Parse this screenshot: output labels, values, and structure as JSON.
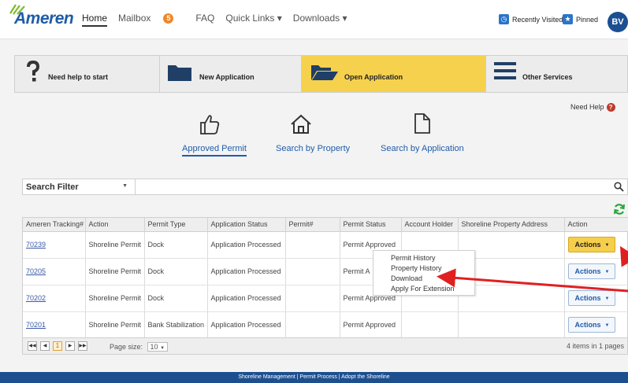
{
  "brand": {
    "name": "Ameren"
  },
  "nav": {
    "items": [
      {
        "label": "Home"
      },
      {
        "label": "Mailbox",
        "badge": "5"
      },
      {
        "label": "FAQ"
      },
      {
        "label": "Quick Links ▾"
      },
      {
        "label": "Downloads ▾"
      }
    ]
  },
  "topRight": {
    "recent": "Recently Visited",
    "pinned": "Pinned",
    "avatar": "BV"
  },
  "tiles": [
    {
      "label": "Need help to start",
      "icon": "question-icon"
    },
    {
      "label": "New Application",
      "icon": "folder-icon"
    },
    {
      "label": "Open Application",
      "icon": "folder-open-icon",
      "highlight_color": "#f6d14e"
    },
    {
      "label": "Other Services",
      "icon": "menu-bars-icon"
    }
  ],
  "help": {
    "label": "Need Help"
  },
  "searchOptions": [
    {
      "label": "Approved Permit",
      "icon": "thumbs-up-icon",
      "selected": true
    },
    {
      "label": "Search by Property",
      "icon": "home-icon"
    },
    {
      "label": "Search by Application",
      "icon": "document-icon"
    }
  ],
  "filter": {
    "label": "Search Filter"
  },
  "table": {
    "headers": [
      "Ameren Tracking#",
      "Action",
      "Permit Type",
      "Application Status",
      "Permit#",
      "Permit Status",
      "Account Holder",
      "Shoreline Property Address",
      "Action"
    ],
    "rows": [
      {
        "tracking": "70239",
        "action": "Shoreline Permit",
        "permit_type": "Dock",
        "app_status": "Application Processed",
        "permit_no": "",
        "permit_status": "Permit Approved",
        "holder": "",
        "address": "",
        "button": "Actions"
      },
      {
        "tracking": "70205",
        "action": "Shoreline Permit",
        "permit_type": "Dock",
        "app_status": "Application Processed",
        "permit_no": "",
        "permit_status": "Permit A",
        "holder": "",
        "address": "",
        "button": "Actions"
      },
      {
        "tracking": "70202",
        "action": "Shoreline Permit",
        "permit_type": "Dock",
        "app_status": "Application Processed",
        "permit_no": "",
        "permit_status": "Permit Approved",
        "holder": "",
        "address": "",
        "button": "Actions"
      },
      {
        "tracking": "70201",
        "action": "Shoreline Permit",
        "permit_type": "Bank Stabilization",
        "app_status": "Application Processed",
        "permit_no": "",
        "permit_status": "Permit Approved",
        "holder": "",
        "address": "",
        "button": "Actions"
      }
    ]
  },
  "actionMenu": {
    "items": [
      "Permit History",
      "Property History",
      "Download",
      "Apply For Extension"
    ]
  },
  "pager": {
    "current_page": "1",
    "size_label": "Page size:",
    "size_value": "10",
    "info": "4 items in 1 pages"
  },
  "footer": {
    "text": "Shoreline Management | Permit Process | Adopt the Shoreline"
  },
  "colors": {
    "accent": "#1f5ca8",
    "highlight": "#f5cf4c",
    "annotation_arrow": "#e02020"
  }
}
